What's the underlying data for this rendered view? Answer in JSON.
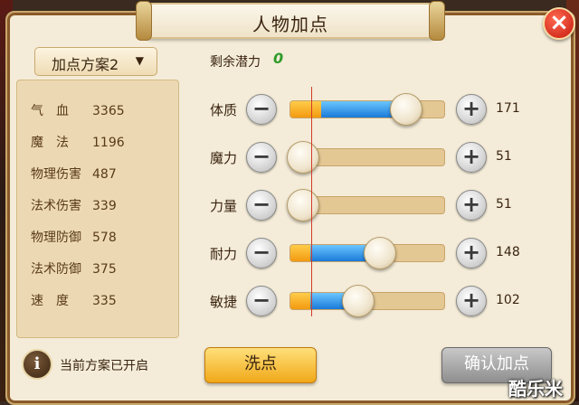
{
  "title": "人物加点",
  "scheme": {
    "label": "加点方案2"
  },
  "stats": [
    {
      "label": "气　血",
      "value": "3365"
    },
    {
      "label": "魔　法",
      "value": "1196"
    },
    {
      "label": "物理伤害",
      "value": "487"
    },
    {
      "label": "法术伤害",
      "value": "339"
    },
    {
      "label": "物理防御",
      "value": "578"
    },
    {
      "label": "法术防御",
      "value": "375"
    },
    {
      "label": "速　度",
      "value": "335"
    }
  ],
  "info_text": "当前方案已开启",
  "potential": {
    "label": "剩余潜力",
    "value": "0"
  },
  "attributes": [
    {
      "label": "体质",
      "value": "171",
      "fill_orange": 0.2,
      "fill_blue": 0.55
    },
    {
      "label": "魔力",
      "value": "51",
      "fill_orange": 0.08,
      "fill_blue": 0.0
    },
    {
      "label": "力量",
      "value": "51",
      "fill_orange": 0.08,
      "fill_blue": 0.0
    },
    {
      "label": "耐力",
      "value": "148",
      "fill_orange": 0.13,
      "fill_blue": 0.45
    },
    {
      "label": "敏捷",
      "value": "102",
      "fill_orange": 0.13,
      "fill_blue": 0.31
    }
  ],
  "buttons": {
    "wash": "洗点",
    "confirm": "确认加点",
    "minus": "−",
    "plus": "+"
  },
  "watermark": "酷乐米",
  "colors": {
    "potential": "#2f9a2a",
    "accent_orange": "#f39a10",
    "accent_blue": "#1a7ad8",
    "close": "#c4180e"
  }
}
